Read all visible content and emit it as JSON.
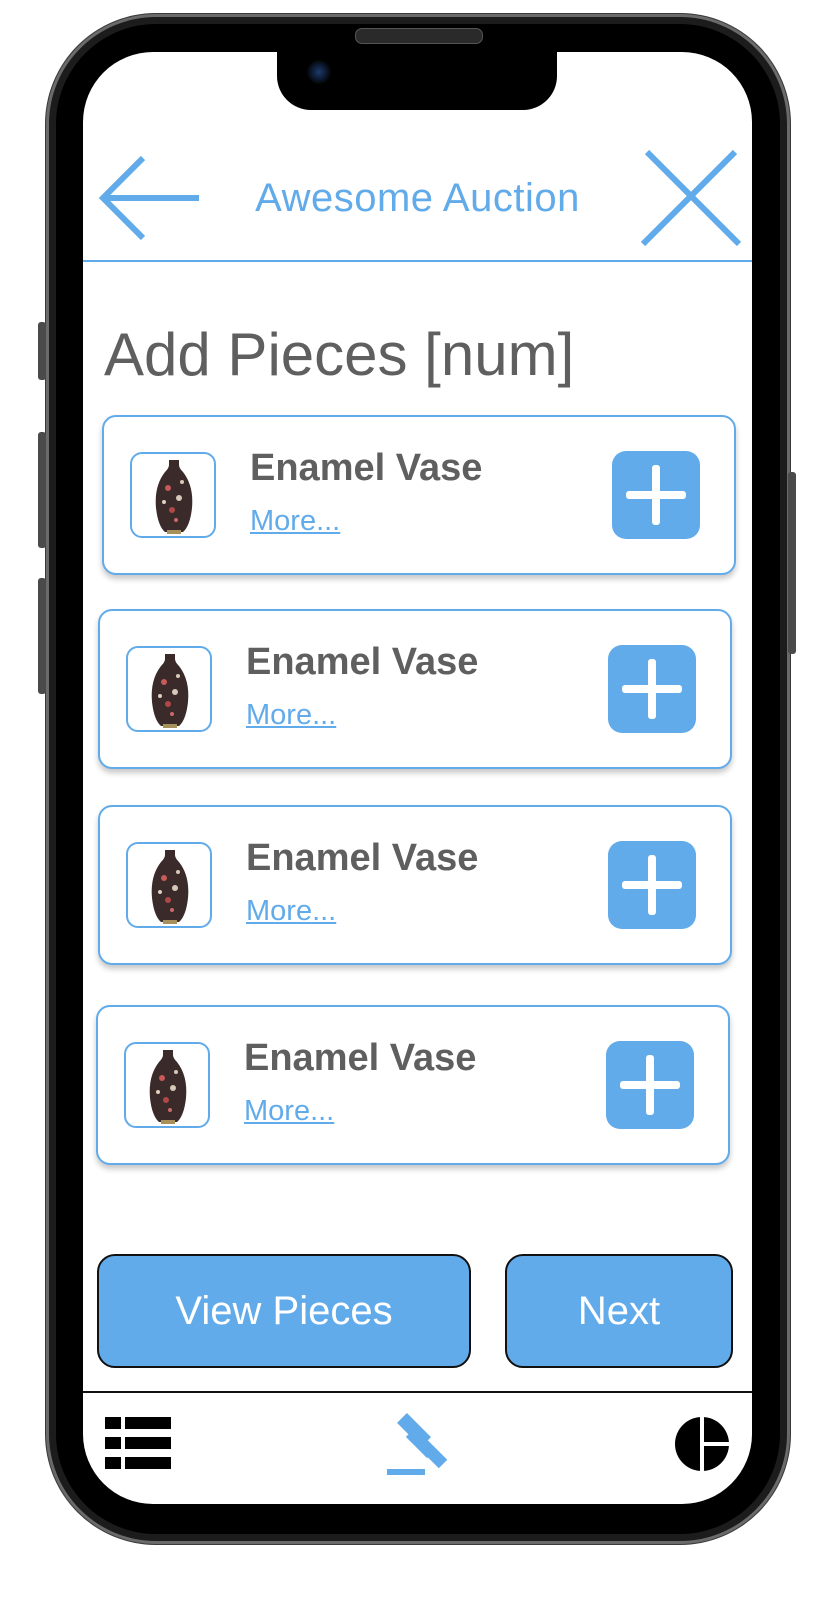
{
  "header": {
    "title": "Awesome Auction",
    "back_icon": "arrow-left-icon",
    "close_icon": "close-icon"
  },
  "page": {
    "title": "Add Pieces [num]"
  },
  "items": [
    {
      "name": "Enamel Vase",
      "more": "More...",
      "thumbnail": "vase-thumbnail",
      "add_icon": "plus-icon"
    },
    {
      "name": "Enamel Vase",
      "more": "More...",
      "thumbnail": "vase-thumbnail",
      "add_icon": "plus-icon"
    },
    {
      "name": "Enamel Vase",
      "more": "More...",
      "thumbnail": "vase-thumbnail",
      "add_icon": "plus-icon"
    },
    {
      "name": "Enamel Vase",
      "more": "More...",
      "thumbnail": "vase-thumbnail",
      "add_icon": "plus-icon"
    }
  ],
  "actions": {
    "view_pieces": "View Pieces",
    "next": "Next"
  },
  "tabbar": {
    "items": [
      {
        "icon": "list-icon"
      },
      {
        "icon": "gavel-icon",
        "active": true
      },
      {
        "icon": "pie-chart-icon"
      }
    ]
  },
  "colors": {
    "accent": "#62abea",
    "text": "#5f5f5f",
    "frame": "#1c1c1c"
  }
}
